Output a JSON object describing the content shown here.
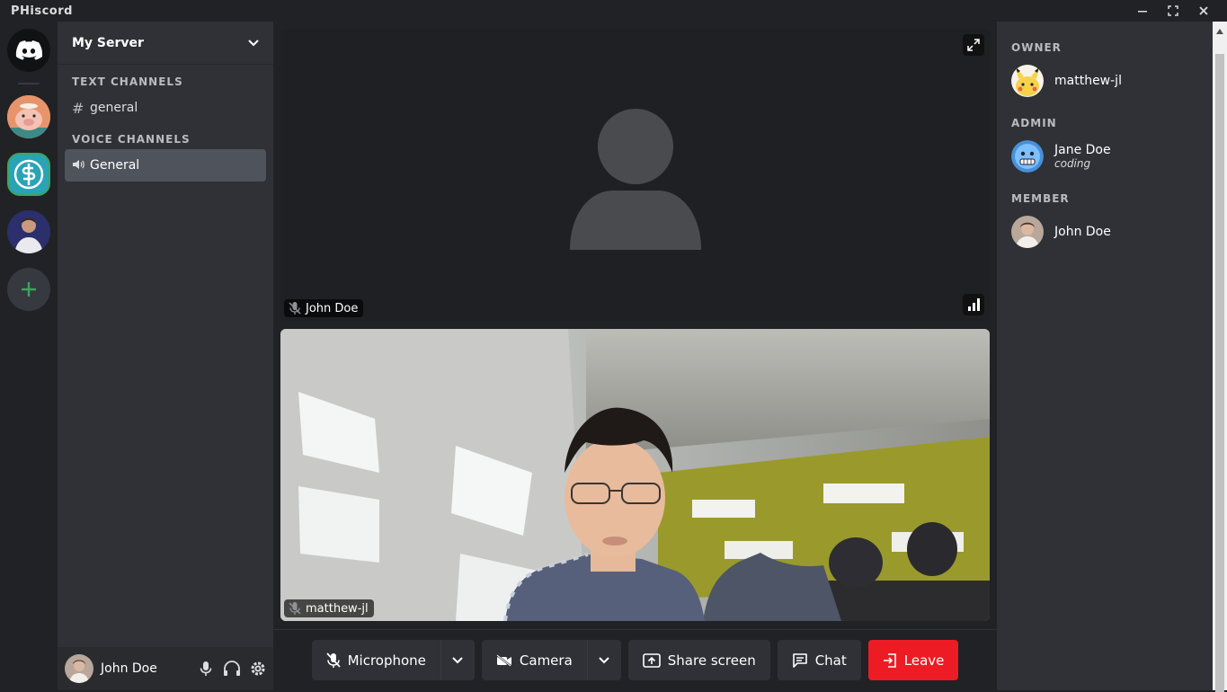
{
  "window": {
    "title": "PHiscord"
  },
  "server": {
    "name": "My Server"
  },
  "channels": {
    "text_category": "TEXT CHANNELS",
    "text": [
      {
        "name": "general"
      }
    ],
    "voice_category": "VOICE CHANNELS",
    "voice": [
      {
        "name": "General"
      }
    ]
  },
  "current_user": {
    "name": "John Doe"
  },
  "tiles": [
    {
      "label": "John Doe",
      "muted": true
    },
    {
      "label": "matthew-jl",
      "muted": true
    }
  ],
  "controls": {
    "microphone": "Microphone",
    "camera": "Camera",
    "share": "Share screen",
    "chat": "Chat",
    "leave": "Leave"
  },
  "members": {
    "owner_label": "OWNER",
    "owner": [
      {
        "name": "matthew-jl"
      }
    ],
    "admin_label": "ADMIN",
    "admin": [
      {
        "name": "Jane Doe",
        "status": "coding"
      }
    ],
    "member_label": "MEMBER",
    "member": [
      {
        "name": "John Doe"
      }
    ]
  },
  "colors": {
    "accent_green": "#3ba55d",
    "leave_red": "#ed1c24",
    "brand": "#5865f2"
  }
}
